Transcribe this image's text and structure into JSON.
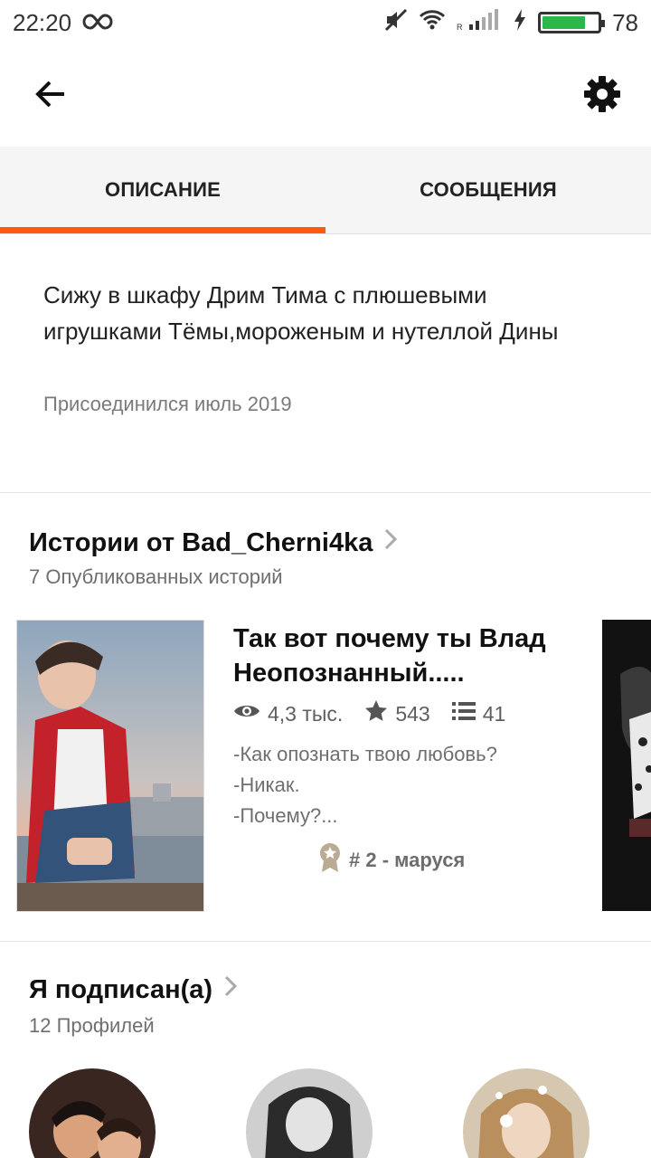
{
  "status_bar": {
    "time": "22:20",
    "battery": "78",
    "battery_level": 0.78,
    "battery_color": "#2db64a",
    "icons": [
      "infinity-icon",
      "mute-icon",
      "wifi-icon",
      "signal-icon",
      "charging-icon",
      "battery-icon"
    ]
  },
  "toolbar": {
    "back_icon": "arrow-left-icon",
    "settings_icon": "gear-icon"
  },
  "tabs": [
    {
      "label": "ОПИСАНИЕ",
      "active": true
    },
    {
      "label": "СООБЩЕНИЯ",
      "active": false
    }
  ],
  "accent_color": "#ff5a12",
  "about": {
    "description": "Сижу в шкафу Дрим Тима с плюшевыми игрушками Тёмы,мороженым и нутеллой Дины",
    "joined": "Присоединился июль 2019"
  },
  "stories": {
    "title": "Истории от Bad_Cherni4ka",
    "subtitle": "7 Опубликованных историй",
    "items": [
      {
        "title": "Так вот почему ты Влад Неопознанный.....",
        "reads": "4,3 тыс.",
        "votes": "543",
        "parts": "41",
        "description": "-Как опознать твою любовь?\n-Никак.\n-Почему?...",
        "rank": "# 2 - маруся"
      }
    ]
  },
  "following": {
    "title": "Я подписан(а)",
    "subtitle": "12 Профилей"
  }
}
